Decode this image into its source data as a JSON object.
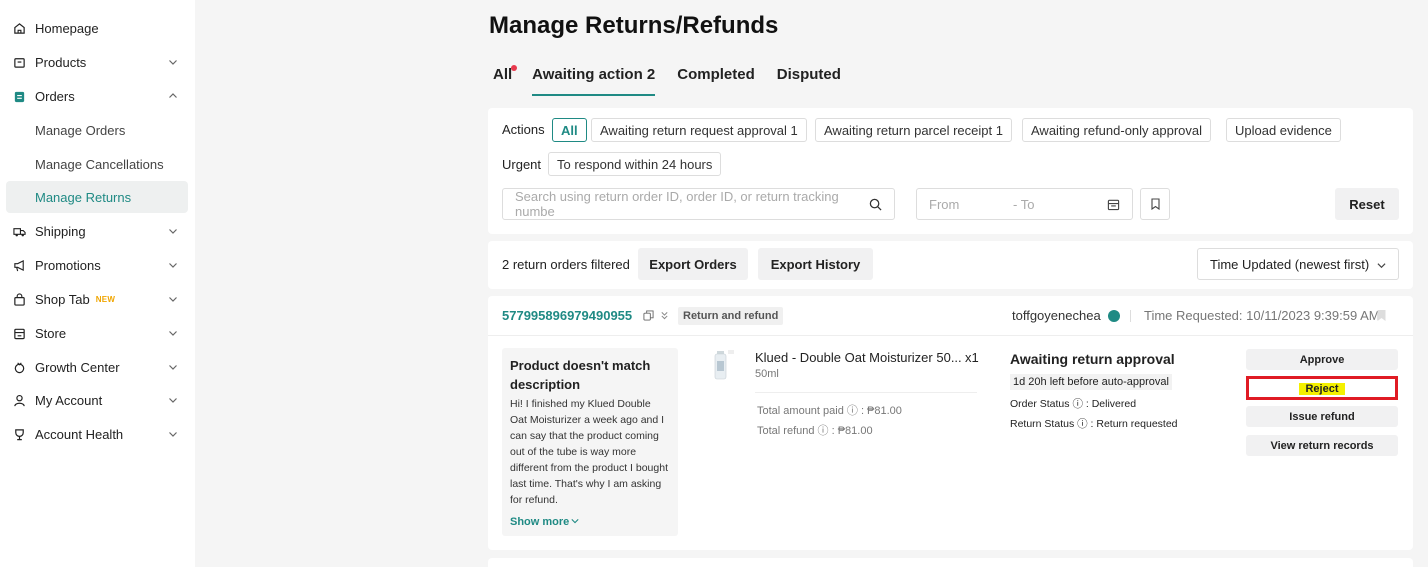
{
  "sidebar": {
    "items": [
      {
        "label": "Homepage",
        "icon": "home-icon"
      },
      {
        "label": "Products",
        "icon": "box-icon"
      },
      {
        "label": "Orders",
        "icon": "clipboard-icon"
      },
      {
        "label": "Manage Orders"
      },
      {
        "label": "Manage Cancellations"
      },
      {
        "label": "Manage Returns"
      },
      {
        "label": "Shipping",
        "icon": "truck-icon"
      },
      {
        "label": "Promotions",
        "icon": "megaphone-icon"
      },
      {
        "label": "Shop Tab",
        "icon": "shopping-bag-icon",
        "badge": "NEW"
      },
      {
        "label": "Store",
        "icon": "store-icon"
      },
      {
        "label": "Growth Center",
        "icon": "growth-icon"
      },
      {
        "label": "My Account",
        "icon": "user-icon"
      },
      {
        "label": "Account Health",
        "icon": "trophy-icon"
      }
    ]
  },
  "page": {
    "title": "Manage Returns/Refunds"
  },
  "tabs": [
    "All",
    "Awaiting action 2",
    "Completed",
    "Disputed"
  ],
  "filters": {
    "actions_label": "Actions",
    "actions": [
      "All",
      "Awaiting return request approval 1",
      "Awaiting return parcel receipt 1",
      "Awaiting refund-only approval",
      "Upload evidence"
    ],
    "urgent_label": "Urgent",
    "urgent": [
      "To respond within 24 hours"
    ],
    "search_placeholder": "Search using return order ID, order ID, or return tracking numbe",
    "date_from": "From",
    "date_to": "- To",
    "reset": "Reset"
  },
  "summary": {
    "count_text": "2 return orders filtered",
    "export_orders": "Export Orders",
    "export_history": "Export History",
    "sort": "Time Updated (newest first)"
  },
  "order": {
    "id": "577995896979490955",
    "type": "Return and refund",
    "buyer": "toffgoyenechea",
    "time_requested": "Time Requested: 10/11/2023 9:39:59 AM",
    "reason_title": "Product doesn't match description",
    "reason_body": "Hi! I finished my Klued Double Oat Moisturizer a week ago and I can say that the product coming out of the tube is way more different from the product I bought last time. That's why I am asking for refund.",
    "show_more": "Show more",
    "product_name": "Klued - Double Oat Moisturizer 50...",
    "qty": "x1",
    "variant": "50ml",
    "total_paid": "Total amount paid ⓘ : ₱81.00",
    "total_refund": "Total refund ⓘ : ₱81.00",
    "status_title": "Awaiting return approval",
    "countdown": "1d 20h left before auto-approval",
    "order_status": "Order Status ⓘ : Delivered",
    "return_status": "Return Status ⓘ : Return requested",
    "buttons": {
      "approve": "Approve",
      "reject": "Reject",
      "issue_refund": "Issue refund",
      "view_records": "View return records"
    }
  },
  "colors": {
    "accent": "#1f8a84",
    "highlight_border": "#e01b24",
    "highlight_fill": "#f4f000",
    "tab_dot": "#e8394d"
  }
}
